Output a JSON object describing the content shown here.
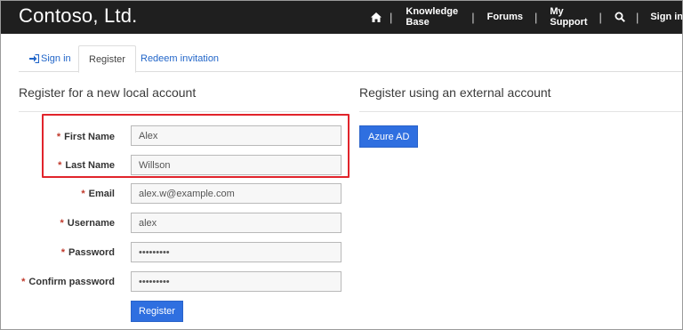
{
  "header": {
    "brand": "Contoso, Ltd.",
    "nav": {
      "home_icon": "home-icon",
      "knowledge_base": "Knowledge Base",
      "forums": "Forums",
      "my_support": "My Support",
      "search_icon": "search-icon",
      "sign_in": "Sign in",
      "separator": "|"
    }
  },
  "tabs": [
    {
      "label": "Sign in",
      "icon": "sign-in-icon"
    },
    {
      "label": "Register",
      "active": true
    },
    {
      "label": "Redeem invitation"
    }
  ],
  "local": {
    "heading": "Register for a new local account",
    "required_marker": "*",
    "fields": {
      "first_name": {
        "label": "First Name",
        "value": "Alex"
      },
      "last_name": {
        "label": "Last Name",
        "value": "Willson"
      },
      "email": {
        "label": "Email",
        "value": "alex.w@example.com"
      },
      "username": {
        "label": "Username",
        "value": "alex"
      },
      "password": {
        "label": "Password",
        "value": "•••••••••"
      },
      "confirm_password": {
        "label": "Confirm password",
        "value": "•••••••••"
      }
    },
    "register_button": "Register"
  },
  "external": {
    "heading": "Register using an external account",
    "azure_button": "Azure AD"
  },
  "colors": {
    "topbar": "#1f1f1f",
    "link": "#2266c9",
    "button": "#2f6fe0",
    "highlight": "#e1242b",
    "required": "#c0392b"
  }
}
